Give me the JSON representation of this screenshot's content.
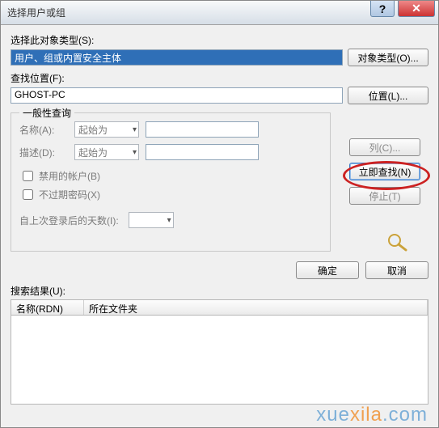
{
  "window": {
    "title": "选择用户或组"
  },
  "sections": {
    "object_type_label": "选择此对象类型(S):",
    "object_type_value": "用户、组或内置安全主体",
    "object_type_btn": "对象类型(O)...",
    "location_label": "查找位置(F):",
    "location_value": "GHOST-PC",
    "location_btn": "位置(L)..."
  },
  "query": {
    "legend": "一般性查询",
    "name_label": "名称(A):",
    "desc_label": "描述(D):",
    "combo_option": "起始为",
    "name_value": "",
    "desc_value": "",
    "chk_disabled": "禁用的帐户(B)",
    "chk_noexpire": "不过期密码(X)",
    "days_label": "自上次登录后的天数(I):",
    "days_value": ""
  },
  "right": {
    "columns_btn": "列(C)...",
    "findnow_btn": "立即查找(N)",
    "stop_btn": "停止(T)"
  },
  "bottom": {
    "ok": "确定",
    "cancel": "取消",
    "results_label": "搜索结果(U):",
    "col_name": "名称(RDN)",
    "col_folder": "所在文件夹"
  },
  "watermark": {
    "a": "xue",
    "b": "xila",
    "c": ".com"
  }
}
